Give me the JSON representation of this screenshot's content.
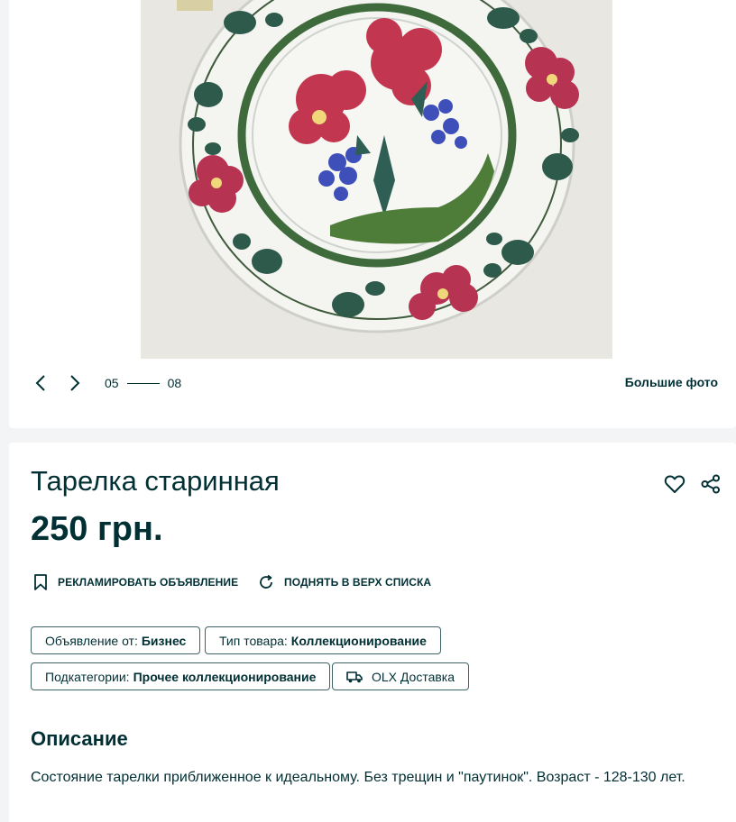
{
  "gallery": {
    "counter_current": "05",
    "counter_total": "08",
    "big_photos_label": "Большие фото",
    "photo_subject": "decorated-plate-photo"
  },
  "ad": {
    "title": "Тарелка старинная",
    "price": "250 грн.",
    "actions": {
      "promote_label": "РЕКЛАМИРОВАТЬ ОБЪЯВЛЕНИЕ",
      "raise_label": "ПОДНЯТЬ В ВЕРХ СПИСКА"
    },
    "tags": [
      {
        "label": "Объявление от:",
        "value": "Бизнес"
      },
      {
        "label": "Тип товара:",
        "value": "Коллекционирование"
      },
      {
        "label": "Подкатегории:",
        "value": "Прочее коллекционирование"
      },
      {
        "label": "OLX Доставка",
        "value": ""
      }
    ],
    "description_title": "Описание",
    "description_text": "Состояние тарелки приближенное к идеальному. Без трещин и \"паутинок\". Возраст - 128-130 лет."
  },
  "icons": {
    "prev": "chevron-left-icon",
    "next": "chevron-right-icon",
    "favorite": "heart-icon",
    "share": "share-icon",
    "promote": "bookmark-icon",
    "raise": "refresh-icon",
    "delivery": "truck-icon"
  },
  "colors": {
    "text": "#002f34",
    "background": "#f2f4f5",
    "card": "#ffffff",
    "tag_border": "#406367"
  }
}
